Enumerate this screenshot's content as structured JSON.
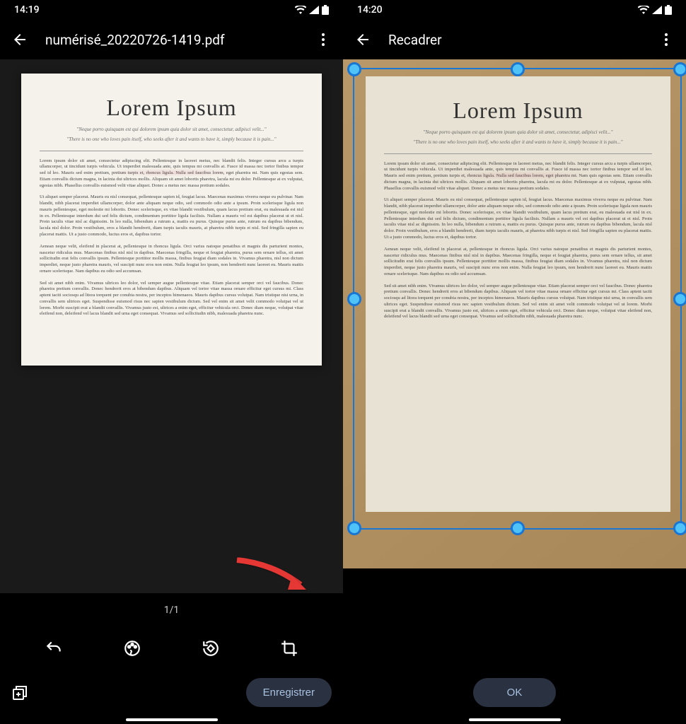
{
  "left": {
    "status": {
      "time": "14:19"
    },
    "appbar": {
      "title": "numérisé_20220726-1419.pdf"
    },
    "document": {
      "title": "Lorem Ipsum",
      "quote1": "\"Neque porro quisquam est qui dolorem ipsum quia dolor sit amet, consectetur, adipisci velit...\"",
      "quote2": "\"There is no one who loves pain itself, who seeks after it and wants to have it, simply because it is pain...\"",
      "para1": "Lorem ipsum dolor sit amet, consectetur adipiscing elit. Pellentesque in laoreet metus, nec blandit felis. Integer cursus arcu a turpis ullamcorper, ut tincidunt turpis vehicula. Ut imperdiet malesuada ante, quis tempus mi convallis at. Fusce id massa nec tortor finibus tempor sed id leo. Mauris sed enim pretium, pretium turpis et, rhoncus ligula. Nulla sed faucibus lorem, eget pharetra mi. Nam quis egestas sem. Etiam convallis dictum magna, in lacinia dui ultrices mollis. Aliquam sit amet lobortis pharetra, lacula mi eu dolor. Pellentesque at ex vulputat, egestas nibh. Phasellus convallis euismod velit vitae aliquet. Donec a metus nec massa pretium sodales.",
      "para2": "Ut aliquet semper placerat. Mauris eu nisl consequat, pellentesque sapien id, feugiat lacus. Maecenas maximus viverra neque eu pulvinar. Nam blandit, nibh placerat imperdiet ullamcorper, dolor ante aliquam neque odio, sed commodo odio ante a ipsum. Proin scelerisque ligula non mauris pellentesque, eget molestie mi lobortis. Donec scelerisque, ex vitae blandit vestibulum, quam lacus pretium erat, eu malesuada est nisl in ex. Pellentesque interdum dui sed felis dictum, condimentum porttitor ligula facilisis. Nullam a mauris vel est dapibus placerat ut et nisl. Proin iaculis vitae nisl ac dignissim. In leo nulla, bibendum a rutrum a, mattis eu purus. Quisque purus ante, rutrum eu dapibus bibendum, lacula nisl dolor. Proin vestibulum, eros a blandit hendrerit, diam turpis iaculis mauris, at pharetra nibh turpis et nisl. Sed fringilla sapien eu placerat mattis. Ut a justo commodo, luctus eros et, dapibus tortor.",
      "para3": "Aenean neque velit, eleifend in placerat at, pellentesque in rhoncus ligula. Orci varius natoque penatibus et magnis dis parturient montes, nascetur ridiculus mus. Maecenas finibus nisl nisl in dapibus. Maecenas fringilla, neque et feugiat pharetra, purus sem ornare tellus, sit amet sollicitudin erat felis convallis ipsum. Pellentesque porttitor mollis massa, finibus feugiat diam sodales in. Vivamus pharetra, nisl non dictum imperdiet, neque justo pharetra mauris, vel suscipit nunc eros non enim. Nulla feugiat leo ipsum, non hendrerit nunc laoreet eu. Mauris mattis ornare scelerisque. Nam dapibus eu odio sed accumsan.",
      "para4": "Sed sit amet nibh enim. Vivamus ultrices leo dolor, vel semper augue pellentesque vitae. Etiam placerat semper orci vel faucibus. Donec pharetra pretium convallis. Donec hendrerit eros at bibendum dapibus. Aliquam vel tortor vitae massa ornare efficitur eget cursus mi. Class aptent taciti sociosqu ad litora torquent per conubia nostra, per inceptos himenaeos. Mauris dapibus cursus volutpat. Nam tristique nisi urna, in convallis sem ultrices eget. Suspendisse euismod risus nec sapien vestibulum dictum. Sed vel enim sit amet velit commodo volutpat vel ut lorem. Morbi suscipit erat a blandit convallis. Vivamus justo est, ultrices a enim eget, efficitur vehicula orci. Donec diam neque, volutpat vitae eleifend non, deleifend vel lacus blandit sed urna eget consequat. Vivamus sed sollicitudin nibh, malesuada pharetra nunc."
    },
    "pageCounter": "1/1",
    "saveLabel": "Enregistrer"
  },
  "right": {
    "status": {
      "time": "14:20"
    },
    "appbar": {
      "title": "Recadrer"
    },
    "okLabel": "OK"
  }
}
